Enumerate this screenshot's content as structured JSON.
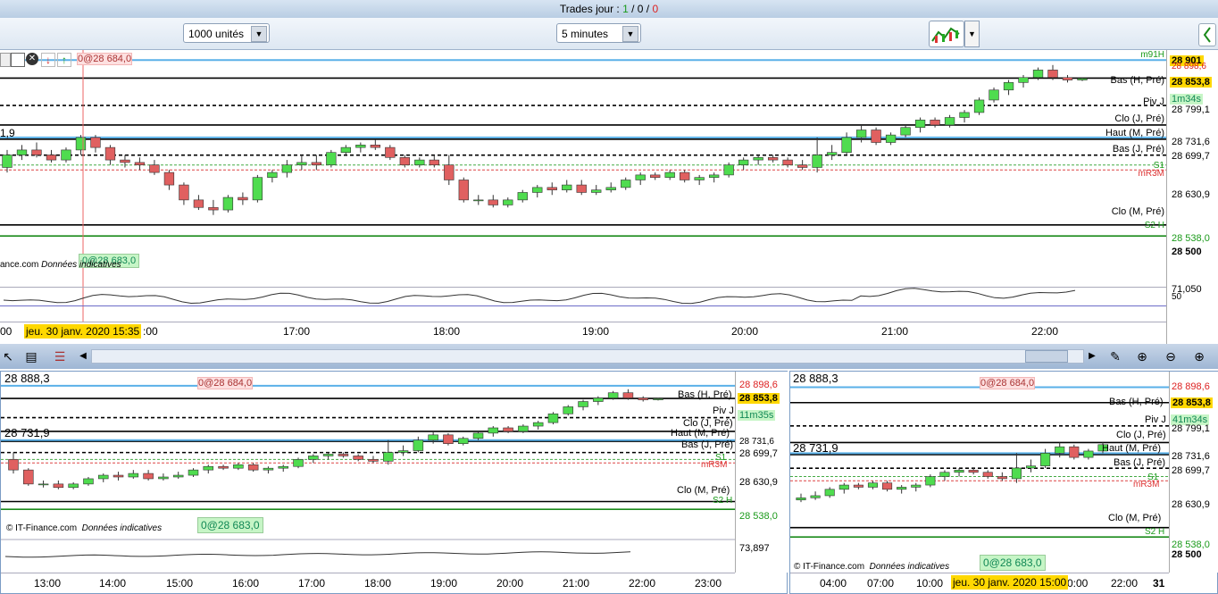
{
  "header": {
    "title_prefix": "Trades jour : ",
    "count_a": "1",
    "sep1": " / ",
    "count_b": "0",
    "sep2": " / ",
    "count_c": "0"
  },
  "toolbar": {
    "quantity": "1000 unités",
    "timeframe": "5 minutes"
  },
  "main_chart": {
    "order_tag_top": "0@28 684,0",
    "order_tag_bottom": "0@28 683,0",
    "left_value": "1,9",
    "credit": "ance.com",
    "credit_note": "Données indicatives",
    "date_badge": "jeu. 30 janv. 2020 15:35",
    "times": [
      "00",
      ":00",
      "17:00",
      "18:00",
      "19:00",
      "20:00",
      "21:00",
      "22:00"
    ],
    "labels": {
      "m91h": "m91H",
      "bas_h": "Bas (H, Pré)",
      "pivj": "Piv J",
      "clo_j": "Clo (J, Pré)",
      "haut_m": "Haut (M, Pré)",
      "bas_j": "Bas (J, Pré)",
      "s1": "S1",
      "mr3m": "mR3M",
      "clo_m": "Clo (M, Pré)",
      "s2h": "S2 H"
    },
    "prices": {
      "p1": "28 901",
      "p2": "28 898,6",
      "p3": "28 853,8",
      "p4": "1m34s",
      "p5": "28 799,1",
      "p6": "28 731,6",
      "p7": "28 699,7",
      "p8": "28 630,9",
      "p9": "28 538,0",
      "p10": "28 500",
      "p11": "71,050",
      "p12": "50"
    },
    "oscillator_color": "#333333",
    "chart_data": {
      "type": "candlestick",
      "x": [
        "16:00",
        "16:05",
        "16:10",
        "16:15",
        "16:20",
        "16:25",
        "16:30",
        "16:35",
        "16:40",
        "16:45",
        "16:50",
        "16:55",
        "17:00",
        "17:05",
        "17:10",
        "17:15",
        "17:20",
        "17:25",
        "17:30",
        "17:35",
        "17:40",
        "17:45",
        "17:50",
        "17:55",
        "18:00",
        "18:05",
        "18:10",
        "18:15",
        "18:20",
        "18:25",
        "18:30",
        "18:35",
        "18:40",
        "18:45",
        "18:50",
        "18:55",
        "19:00",
        "19:05",
        "19:10",
        "19:15",
        "19:20",
        "19:25",
        "19:30",
        "19:35",
        "19:40",
        "19:45",
        "19:50",
        "19:55",
        "20:00",
        "20:05",
        "20:10",
        "20:15",
        "20:20",
        "20:25",
        "20:30",
        "20:35",
        "20:40",
        "20:45",
        "20:50",
        "20:55",
        "21:00",
        "21:05",
        "21:10",
        "21:15",
        "21:20",
        "21:25",
        "21:30",
        "21:35",
        "21:40",
        "21:45",
        "21:50",
        "21:55",
        "22:00",
        "22:05",
        "22:10",
        "22:15"
      ],
      "ohlc": [
        [
          28675,
          28710,
          28665,
          28700
        ],
        [
          28700,
          28720,
          28690,
          28710
        ],
        [
          28710,
          28725,
          28695,
          28700
        ],
        [
          28700,
          28710,
          28685,
          28690
        ],
        [
          28690,
          28715,
          28685,
          28710
        ],
        [
          28710,
          28740,
          28700,
          28735
        ],
        [
          28735,
          28740,
          28705,
          28715
        ],
        [
          28715,
          28720,
          28680,
          28690
        ],
        [
          28690,
          28700,
          28675,
          28685
        ],
        [
          28685,
          28695,
          28670,
          28680
        ],
        [
          28680,
          28690,
          28660,
          28665
        ],
        [
          28665,
          28670,
          28630,
          28640
        ],
        [
          28640,
          28645,
          28600,
          28610
        ],
        [
          28610,
          28620,
          28590,
          28595
        ],
        [
          28595,
          28610,
          28580,
          28590
        ],
        [
          28590,
          28620,
          28585,
          28615
        ],
        [
          28615,
          28625,
          28600,
          28610
        ],
        [
          28610,
          28660,
          28605,
          28655
        ],
        [
          28655,
          28670,
          28645,
          28665
        ],
        [
          28665,
          28690,
          28655,
          28680
        ],
        [
          28680,
          28700,
          28670,
          28685
        ],
        [
          28685,
          28700,
          28670,
          28680
        ],
        [
          28680,
          28710,
          28675,
          28705
        ],
        [
          28705,
          28720,
          28700,
          28715
        ],
        [
          28715,
          28725,
          28705,
          28720
        ],
        [
          28720,
          28730,
          28710,
          28715
        ],
        [
          28715,
          28720,
          28690,
          28695
        ],
        [
          28695,
          28700,
          28675,
          28680
        ],
        [
          28680,
          28695,
          28675,
          28690
        ],
        [
          28690,
          28700,
          28675,
          28680
        ],
        [
          28680,
          28700,
          28640,
          28650
        ],
        [
          28650,
          28655,
          28605,
          28610
        ],
        [
          28610,
          28620,
          28600,
          28610
        ],
        [
          28610,
          28620,
          28595,
          28600
        ],
        [
          28600,
          28615,
          28595,
          28610
        ],
        [
          28610,
          28630,
          28605,
          28625
        ],
        [
          28625,
          28640,
          28615,
          28635
        ],
        [
          28635,
          28645,
          28620,
          28630
        ],
        [
          28630,
          28650,
          28625,
          28640
        ],
        [
          28640,
          28650,
          28620,
          28625
        ],
        [
          28625,
          28640,
          28620,
          28630
        ],
        [
          28630,
          28645,
          28625,
          28635
        ],
        [
          28635,
          28655,
          28630,
          28650
        ],
        [
          28650,
          28665,
          28640,
          28660
        ],
        [
          28660,
          28665,
          28650,
          28655
        ],
        [
          28655,
          28670,
          28650,
          28665
        ],
        [
          28665,
          28670,
          28645,
          28650
        ],
        [
          28650,
          28660,
          28640,
          28655
        ],
        [
          28655,
          28665,
          28645,
          28660
        ],
        [
          28660,
          28685,
          28655,
          28680
        ],
        [
          28680,
          28695,
          28670,
          28690
        ],
        [
          28690,
          28700,
          28680,
          28695
        ],
        [
          28695,
          28700,
          28685,
          28690
        ],
        [
          28690,
          28695,
          28675,
          28680
        ],
        [
          28680,
          28690,
          28670,
          28675
        ],
        [
          28675,
          28735,
          28665,
          28700
        ],
        [
          28700,
          28720,
          28690,
          28705
        ],
        [
          28705,
          28745,
          28700,
          28735
        ],
        [
          28735,
          28760,
          28725,
          28750
        ],
        [
          28750,
          28755,
          28720,
          28725
        ],
        [
          28725,
          28745,
          28720,
          28740
        ],
        [
          28740,
          28760,
          28735,
          28755
        ],
        [
          28755,
          28775,
          28745,
          28770
        ],
        [
          28770,
          28775,
          28755,
          28760
        ],
        [
          28760,
          28780,
          28755,
          28775
        ],
        [
          28775,
          28790,
          28765,
          28785
        ],
        [
          28785,
          28815,
          28780,
          28810
        ],
        [
          28810,
          28835,
          28805,
          28830
        ],
        [
          28830,
          28850,
          28820,
          28845
        ],
        [
          28845,
          28860,
          28835,
          28855
        ],
        [
          28855,
          28875,
          28850,
          28870
        ],
        [
          28870,
          28880,
          28850,
          28855
        ],
        [
          28855,
          28860,
          28845,
          28850
        ],
        [
          28850,
          28855,
          28848,
          28853
        ]
      ],
      "ylim": [
        28490,
        28910
      ],
      "levels": [
        {
          "name": "Bas (H, Pré)",
          "value": 28853.8
        },
        {
          "name": "Piv J",
          "value": 28799.1
        },
        {
          "name": "Clo (J, Pré)",
          "value": 28760
        },
        {
          "name": "Haut (M, Pré)",
          "value": 28731.6
        },
        {
          "name": "Bas (J, Pré)",
          "value": 28699.7
        },
        {
          "name": "Clo (M, Pré)",
          "value": 28560
        },
        {
          "name": "S2 H",
          "value": 28538.0
        }
      ]
    }
  },
  "bottom_left": {
    "top_left_value": "28 888,3",
    "mid_left_value": "28 731,9",
    "order_tag_top": "0@28 684,0",
    "order_tag_bottom": "0@28 683,0",
    "credit": "© IT-Finance.com",
    "credit_note": "Données indicatives",
    "times": [
      "13:00",
      "14:00",
      "15:00",
      "16:00",
      "17:00",
      "18:00",
      "19:00",
      "20:00",
      "21:00",
      "22:00",
      "23:00"
    ],
    "prices": {
      "p1": "28 898,6",
      "p2": "28 853,8",
      "p3": "11m35s",
      "p4": "28 731,6",
      "p5": "28 699,7",
      "p6": "28 630,9",
      "p7": "28 538,0",
      "p8": "73,897"
    },
    "labels": {
      "bas_h": "Bas (H, Pré)",
      "pivj": "Piv J",
      "clo_j": "Clo (J, Pré)",
      "haut_m": "Haut (M, Pré)",
      "bas_j": "Bas (J, Pré)",
      "s1": "S1",
      "mr3m": "mR3M",
      "clo_m": "Clo (M, Pré)",
      "s2h": "S2 H"
    }
  },
  "bottom_right": {
    "top_left_value": "28 888,3",
    "mid_left_value": "28 731,9",
    "order_tag_top": "0@28 684,0",
    "order_tag_bottom": "0@28 683,0",
    "credit": "© IT-Finance.com",
    "credit_note": "Données indicatives",
    "date_badge": "jeu. 30 janv. 2020 15:00",
    "times": [
      "04:00",
      "07:00",
      "10:00",
      "",
      "0:00",
      "22:00",
      "31"
    ],
    "prices": {
      "p1": "28 898,6",
      "p2": "28 853,8",
      "p3": "41m34s",
      "p4": "28 799,1",
      "p5": "28 731,6",
      "p6": "28 699,7",
      "p7": "28 630,9",
      "p8": "28 538,0",
      "p9": "28 500"
    },
    "labels": {
      "bas_h": "Bas (H, Pré)",
      "pivj": "Piv J",
      "clo_j": "Clo (J, Pré)",
      "haut_m": "Haut (M, Pré)",
      "bas_j": "Bas (J, Pré)",
      "s1": "S1",
      "mr3m": "mR3M",
      "clo_m": "Clo (M, Pré)",
      "s2h": "S2 H"
    }
  }
}
